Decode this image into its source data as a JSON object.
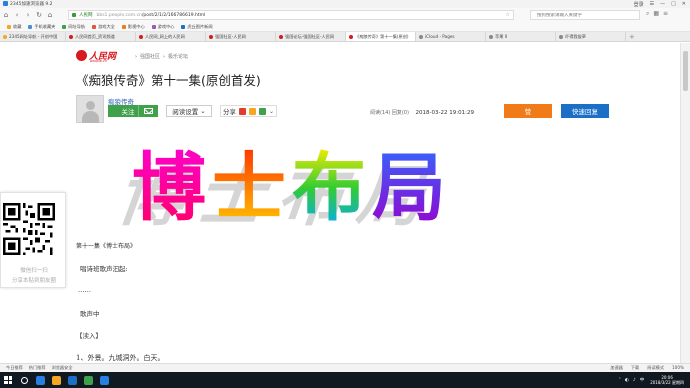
{
  "window": {
    "title": "2345加速浏览器 9.2",
    "controls": [
      "登录",
      "☰",
      "—",
      "□",
      "✕"
    ]
  },
  "nav": {
    "url_domain": "人民网",
    "url_host": "bbs1.people.com.cn",
    "url_path": "/post/2/1/2/166786619.html",
    "search_placeholder": "搜狗搜索请输入关键字"
  },
  "bookmarks": [
    {
      "label": "收藏",
      "color": "#f5a623"
    },
    {
      "label": "手机收藏夹",
      "color": "#4a90d9"
    },
    {
      "label": "网址导航",
      "color": "#3fa14a"
    },
    {
      "label": "游戏大全",
      "color": "#e5533d"
    },
    {
      "label": "影视中心",
      "color": "#f07b18"
    },
    {
      "label": "游戏中心",
      "color": "#9b59b6"
    },
    {
      "label": "虎丘图片新闻",
      "color": "#1b6fc7"
    }
  ],
  "tabs": [
    {
      "label": "2345网址导航 - 开创中国",
      "color": "#f5a623",
      "active": false
    },
    {
      "label": "人民网首页_资讯频道",
      "color": "#d71920",
      "active": false
    },
    {
      "label": "人民网_网上的人民网",
      "color": "#d71920",
      "active": false
    },
    {
      "label": "强国社区-人民网",
      "color": "#d71920",
      "active": false
    },
    {
      "label": "强国论坛-强国社区-人民网",
      "color": "#d71920",
      "active": false
    },
    {
      "label": "《痴狼传奇》第十一集(原创)",
      "color": "#d71920",
      "active": true
    },
    {
      "label": "iCloud - Pages",
      "color": "#888888",
      "active": false
    },
    {
      "label": "苹果 II",
      "color": "#888888",
      "active": false
    },
    {
      "label": "吓得我拔草",
      "color": "#888888",
      "active": false
    }
  ],
  "page": {
    "logo": {
      "text": "人民网",
      "sub": "people.cn"
    },
    "breadcrumb": [
      "强国社区",
      "极乐论坛"
    ],
    "post_title": "《痴狼传奇》第十一集(原创首发)",
    "author": "痴狼传奇",
    "follow_label": "关注",
    "read_settings_label": "阅读设置",
    "share_label": "分享",
    "stats": {
      "reads": "阅读(14)",
      "replies": "回复(0)",
      "date": "2018-03-22 19:01:29"
    },
    "like_label": "赞",
    "reply_label": "快速回复",
    "banner_chars": [
      "博",
      "士",
      "布",
      "局"
    ],
    "qr": {
      "caption1": "微信扫一扫",
      "caption2": "分享本贴到朋友圈"
    },
    "article": {
      "para_title": "第十一集《博士布局》",
      "line2": "唱诗班歌声汩起:",
      "line3": "……",
      "line4": "歌声中",
      "line5": "【渎入】",
      "line6": "1、外景。九城洞外。白天。"
    }
  },
  "status": {
    "left": [
      "今日推荐",
      "热门推荐",
      "浏览器安全"
    ],
    "right": [
      "加速器",
      "下载",
      "阅读模式",
      "100%"
    ]
  },
  "taskbar": {
    "time": "20:06",
    "date": "2018/3/22 星期四",
    "lang": "中",
    "icon_colors": [
      "#ffffff",
      "#2a7de1",
      "#f5a623",
      "#1b6fc7",
      "#3fa14a",
      "#2a7de1"
    ]
  }
}
